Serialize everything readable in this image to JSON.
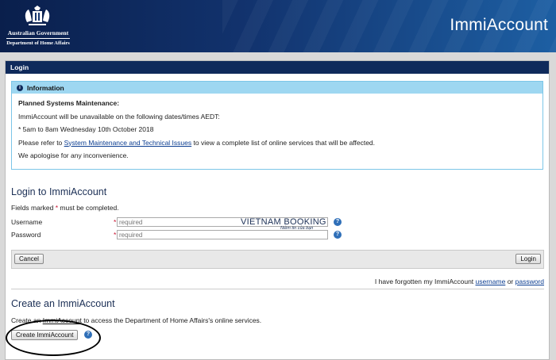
{
  "header": {
    "gov_line1": "Australian Government",
    "gov_line2": "Department of Home Affairs",
    "app_title": "ImmiAccount"
  },
  "panel": {
    "title": "Login"
  },
  "info": {
    "title": "Information",
    "heading": "Planned Systems Maintenance:",
    "line1": "ImmiAccount will be unavailable on the following dates/times AEDT:",
    "line2": "* 5am to 8am Wednesday 10th October 2018",
    "line3_before": "Please refer to ",
    "line3_link": "System Maintenance and Technical Issues",
    "line3_after": " to view a complete list of online services that will be affected.",
    "line4": "We apologise for any inconvenience."
  },
  "login": {
    "heading": "Login to ImmiAccount",
    "fields_note_before": "Fields marked ",
    "fields_note_star": "*",
    "fields_note_after": " must be completed.",
    "username_label": "Username",
    "username_placeholder": "required",
    "password_label": "Password",
    "password_placeholder": "required",
    "star": "*",
    "help": "?",
    "cancel_label": "Cancel",
    "login_label": "Login",
    "forgot_before": "I have forgotten my ImmiAccount ",
    "forgot_username": "username",
    "forgot_or": " or ",
    "forgot_password": "password"
  },
  "watermark": {
    "line1": "VIETNAM BOOKING",
    "line2": "Niềm tin của bạn"
  },
  "create": {
    "heading": "Create an ImmiAccount",
    "text_before": "Create an ",
    "text_link": "ImmiAccount",
    "text_after": " to access the Department of Home Affairs's online services.",
    "button_label": "Create ImmiAccount"
  }
}
